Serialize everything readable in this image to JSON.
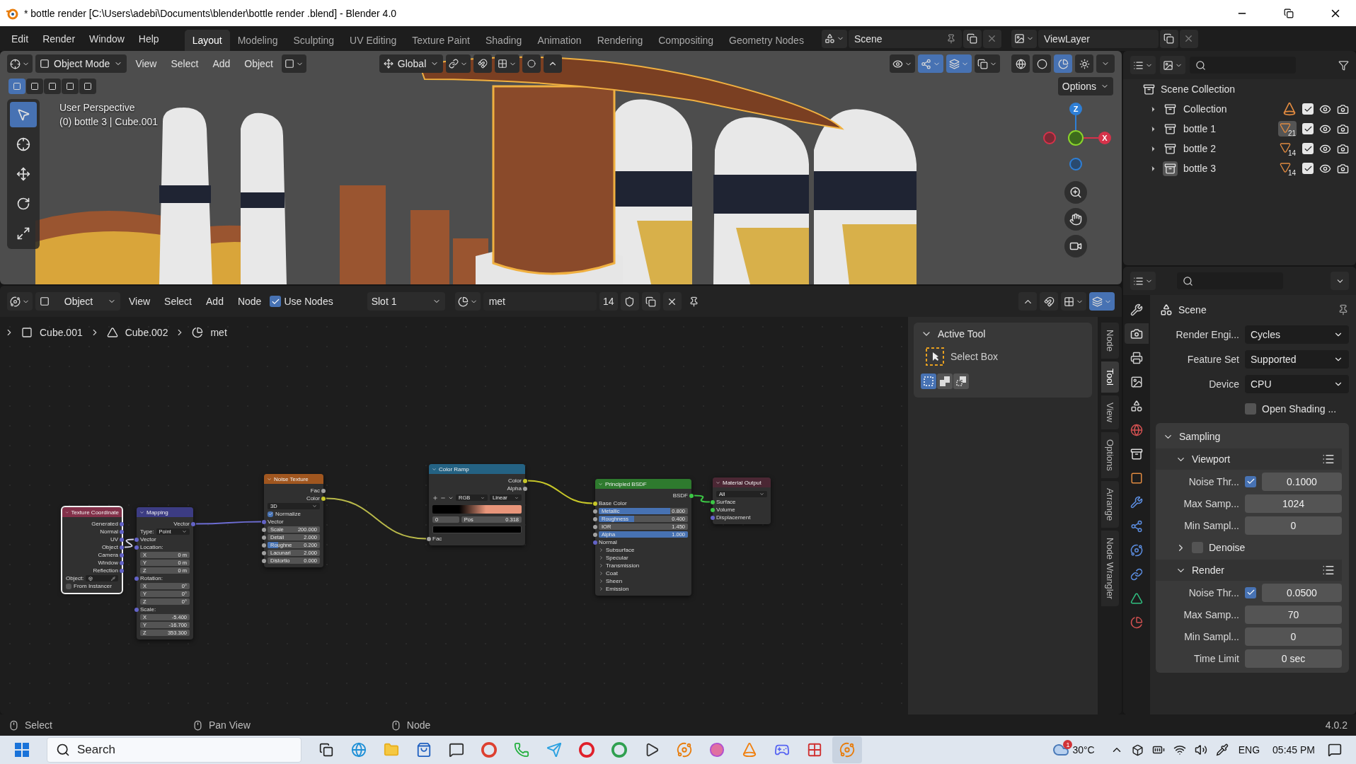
{
  "window": {
    "title": "* bottle render  [C:\\Users\\adebi\\Documents\\blender\\bottle render .blend] - Blender 4.0"
  },
  "menu": [
    "Edit",
    "Render",
    "Window",
    "Help"
  ],
  "workspaces": [
    {
      "label": "Layout",
      "selected": true
    },
    {
      "label": "Modeling",
      "selected": false
    },
    {
      "label": "Sculpting",
      "selected": false
    },
    {
      "label": "UV Editing",
      "selected": false
    },
    {
      "label": "Texture Paint",
      "selected": false
    },
    {
      "label": "Shading",
      "selected": false
    },
    {
      "label": "Animation",
      "selected": false
    },
    {
      "label": "Rendering",
      "selected": false
    },
    {
      "label": "Compositing",
      "selected": false
    },
    {
      "label": "Geometry Nodes",
      "selected": false
    }
  ],
  "scene": {
    "name": "Scene"
  },
  "view_layer": {
    "name": "ViewLayer"
  },
  "viewport": {
    "mode": "Object Mode",
    "menus": [
      "View",
      "Select",
      "Add",
      "Object"
    ],
    "orientation": "Global",
    "options": "Options",
    "info": [
      "User Perspective",
      "(0) bottle 3 | Cube.001"
    ],
    "axes": [
      "Z",
      "X"
    ],
    "toggles": [
      {
        "kind": "visibility",
        "selected": false
      },
      {
        "kind": "gizmo",
        "selected": true
      },
      {
        "kind": "overlay",
        "selected": true
      },
      {
        "kind": "xray",
        "selected": false
      }
    ],
    "shading": [
      {
        "kind": "wireframe",
        "selected": false
      },
      {
        "kind": "solid",
        "selected": false
      },
      {
        "kind": "material",
        "selected": true
      },
      {
        "kind": "rendered",
        "selected": false
      }
    ],
    "tools": [
      {
        "kind": "select",
        "selected": true
      },
      {
        "kind": "cursor",
        "selected": false
      },
      {
        "kind": "move",
        "selected": false
      },
      {
        "kind": "rotate",
        "selected": false
      },
      {
        "kind": "scale",
        "selected": false
      }
    ]
  },
  "node_editor": {
    "editor": "Object",
    "menus": [
      "View",
      "Select",
      "Add",
      "Node"
    ],
    "use_nodes": {
      "label": "Use Nodes",
      "checked": true
    },
    "slot": "Slot 1",
    "material": "met",
    "users": "14",
    "breadcrumbs": [
      {
        "kind": "object",
        "label": "Cube.001"
      },
      {
        "kind": "mesh",
        "label": "Cube.002"
      },
      {
        "kind": "material",
        "label": "met"
      }
    ],
    "nodes": [
      {
        "title": "Texture Coordinate",
        "kind": "input",
        "selected": true,
        "rows": [
          {
            "kind": "output",
            "label": "Generated",
            "color": "#6363c7"
          },
          {
            "kind": "output",
            "label": "Normal",
            "color": "#6363c7"
          },
          {
            "kind": "output",
            "label": "UV",
            "color": "#6363c7"
          },
          {
            "kind": "output",
            "label": "Object",
            "color": "#6363c7"
          },
          {
            "kind": "output",
            "label": "Camera",
            "color": "#6363c7"
          },
          {
            "kind": "output",
            "label": "Window",
            "color": "#6363c7"
          },
          {
            "kind": "output",
            "label": "Reflection",
            "color": "#6363c7"
          },
          {
            "kind": "object_field",
            "label": "Object:"
          },
          {
            "kind": "checkbox",
            "label": "From Instancer",
            "checked": false
          }
        ]
      },
      {
        "title": "Mapping",
        "kind": "vector",
        "selected": false,
        "rows": [
          {
            "kind": "output",
            "label": "Vector",
            "color": "#6363c7"
          },
          {
            "kind": "dropdown",
            "label": "Type:",
            "value": "Point"
          },
          {
            "kind": "input",
            "label": "Vector",
            "color": "#6363c7"
          },
          {
            "kind": "input",
            "label": "Location:",
            "color": "#6363c7"
          },
          {
            "kind": "axis",
            "label": "X",
            "value": "0 m"
          },
          {
            "kind": "axis",
            "label": "Y",
            "value": "0 m"
          },
          {
            "kind": "axis",
            "label": "Z",
            "value": "0 m"
          },
          {
            "kind": "input",
            "label": "Rotation:",
            "color": "#6363c7"
          },
          {
            "kind": "axis",
            "label": "X",
            "value": "0°"
          },
          {
            "kind": "axis",
            "label": "Y",
            "value": "0°"
          },
          {
            "kind": "axis",
            "label": "Z",
            "value": "0°"
          },
          {
            "kind": "input",
            "label": "Scale:",
            "color": "#6363c7"
          },
          {
            "kind": "axis",
            "label": "X",
            "value": "-5.400"
          },
          {
            "kind": "axis",
            "label": "Y",
            "value": "-16.700"
          },
          {
            "kind": "axis",
            "label": "Z",
            "value": "353.300"
          }
        ]
      },
      {
        "title": "Noise Texture",
        "kind": "texture",
        "selected": false,
        "rows": [
          {
            "kind": "output",
            "label": "Fac",
            "color": "#a1a1a1"
          },
          {
            "kind": "output",
            "label": "Color",
            "color": "#c7c729"
          },
          {
            "kind": "dropdown",
            "value": "3D"
          },
          {
            "kind": "checkbox",
            "label": "Normalize",
            "checked": true
          },
          {
            "kind": "input",
            "label": "Vector",
            "color": "#6363c7"
          },
          {
            "kind": "number",
            "label": "Scale",
            "value": "200.000",
            "color": "#a1a1a1"
          },
          {
            "kind": "number",
            "label": "Detail",
            "value": "2.000",
            "color": "#a1a1a1"
          },
          {
            "kind": "slider",
            "label": "Roughne",
            "value": "0.200",
            "level": 0.2,
            "color": "#a1a1a1"
          },
          {
            "kind": "number",
            "label": "Lacunari",
            "value": "2.000",
            "color": "#a1a1a1"
          },
          {
            "kind": "number",
            "label": "Distortio",
            "value": "0.000",
            "color": "#a1a1a1"
          }
        ]
      },
      {
        "title": "Color Ramp",
        "kind": "converter",
        "selected": false,
        "rows": [
          {
            "kind": "output",
            "label": "Color",
            "color": "#c7c729"
          },
          {
            "kind": "output",
            "label": "Alpha",
            "color": "#a1a1a1"
          },
          {
            "kind": "ramp_tools",
            "mode": "RGB",
            "interpolation": "Linear"
          },
          {
            "kind": "ramp"
          },
          {
            "kind": "stop",
            "index": "0",
            "label": "Pos",
            "value": "0.318"
          },
          {
            "kind": "swatch"
          },
          {
            "kind": "input",
            "label": "Fac",
            "color": "#a1a1a1"
          }
        ]
      },
      {
        "title": "Principled BSDF",
        "kind": "shader",
        "selected": false,
        "rows": [
          {
            "kind": "output",
            "label": "BSDF",
            "color": "#3cc745"
          },
          {
            "kind": "input",
            "label": "Base Color",
            "color": "#c7c729"
          },
          {
            "kind": "slider",
            "label": "Metallic",
            "value": "0.800",
            "level": 0.8,
            "color": "#a1a1a1"
          },
          {
            "kind": "slider",
            "label": "Roughness",
            "value": "0.400",
            "level": 0.4,
            "color": "#a1a1a1"
          },
          {
            "kind": "number",
            "label": "IOR",
            "value": "1.450",
            "color": "#a1a1a1"
          },
          {
            "kind": "slider",
            "label": "Alpha",
            "value": "1.000",
            "level": 1,
            "color": "#a1a1a1"
          },
          {
            "kind": "input",
            "label": "Normal",
            "color": "#6363c7"
          },
          {
            "kind": "panel",
            "label": "Subsurface"
          },
          {
            "kind": "panel",
            "label": "Specular"
          },
          {
            "kind": "panel",
            "label": "Transmission"
          },
          {
            "kind": "panel",
            "label": "Coat"
          },
          {
            "kind": "panel",
            "label": "Sheen"
          },
          {
            "kind": "panel",
            "label": "Emission"
          }
        ]
      },
      {
        "title": "Material Output",
        "kind": "output",
        "selected": false,
        "rows": [
          {
            "kind": "dropdown",
            "value": "All"
          },
          {
            "kind": "input",
            "label": "Surface",
            "color": "#3cc745"
          },
          {
            "kind": "input",
            "label": "Volume",
            "color": "#3cc745"
          },
          {
            "kind": "input",
            "label": "Displacement",
            "color": "#6363c7"
          }
        ]
      }
    ],
    "sidebar": {
      "panel": "Active Tool",
      "tool": "Select Box",
      "modes": [
        {
          "kind": "new",
          "selected": true
        },
        {
          "kind": "extend",
          "selected": false
        },
        {
          "kind": "subtract",
          "selected": false
        }
      ]
    },
    "tabs": [
      {
        "label": "Node",
        "selected": false
      },
      {
        "label": "Tool",
        "selected": true
      },
      {
        "label": "View",
        "selected": false
      },
      {
        "label": "Options",
        "selected": false
      },
      {
        "label": "Arrange",
        "selected": false
      },
      {
        "label": "Node Wrangler",
        "selected": false
      }
    ]
  },
  "outliner": {
    "root": {
      "label": "Scene Collection",
      "children": [
        {
          "label": "Collection",
          "kind": "cone",
          "expanded": false,
          "checked": true,
          "selected": false
        },
        {
          "label": "bottle 1",
          "kind": "mesh",
          "count": "21",
          "active_data": true,
          "expanded": false,
          "checked": true,
          "selected": false
        },
        {
          "label": "bottle 2",
          "kind": "mesh",
          "count": "14",
          "active_data": false,
          "expanded": false,
          "checked": true,
          "selected": false
        },
        {
          "label": "bottle 3",
          "kind": "mesh",
          "count": "14",
          "active_data": false,
          "expanded": false,
          "checked": true,
          "selected": true
        }
      ]
    }
  },
  "properties": {
    "tabs": [
      {
        "kind": "tool",
        "selected": false
      },
      {
        "kind": "render",
        "selected": true
      },
      {
        "kind": "output",
        "selected": false
      },
      {
        "kind": "view_layer",
        "selected": false
      },
      {
        "kind": "scene",
        "selected": false
      },
      {
        "kind": "world",
        "selected": false
      },
      {
        "kind": "collection",
        "selected": false
      },
      {
        "kind": "object",
        "selected": false
      },
      {
        "kind": "modifiers",
        "selected": false
      },
      {
        "kind": "particles",
        "selected": false
      },
      {
        "kind": "physics",
        "selected": false
      },
      {
        "kind": "constraints",
        "selected": false
      },
      {
        "kind": "data",
        "selected": false
      },
      {
        "kind": "material",
        "selected": false
      }
    ],
    "context": "Scene",
    "fields": [
      {
        "kind": "dropdown",
        "label": "Render Engi...",
        "value": "Cycles"
      },
      {
        "kind": "dropdown",
        "label": "Feature Set",
        "value": "Supported"
      },
      {
        "kind": "dropdown",
        "label": "Device",
        "value": "CPU"
      },
      {
        "kind": "checkbox",
        "label": "Open Shading ...",
        "checked": false
      }
    ],
    "panels": [
      {
        "title": "Sampling",
        "expanded": true,
        "subpanels": [
          {
            "title": "Viewport",
            "expanded": true,
            "fields": [
              {
                "kind": "toggle_number",
                "label": "Noise Thr...",
                "checked": true,
                "value": "0.1000"
              },
              {
                "kind": "number",
                "label": "Max Samp...",
                "value": "1024"
              },
              {
                "kind": "number",
                "label": "Min Sampl...",
                "value": "0"
              }
            ],
            "children": [
              {
                "title": "Denoise",
                "expanded": false,
                "checked": false
              }
            ]
          },
          {
            "title": "Render",
            "expanded": true,
            "fields": [
              {
                "kind": "toggle_number",
                "label": "Noise Thr...",
                "checked": true,
                "value": "0.0500"
              },
              {
                "kind": "number",
                "label": "Max Samp...",
                "value": "70"
              },
              {
                "kind": "number",
                "label": "Min Sampl...",
                "value": "0"
              },
              {
                "kind": "number",
                "label": "Time Limit",
                "value": "0 sec"
              }
            ]
          }
        ]
      }
    ]
  },
  "status_bar": {
    "hints": [
      "Select",
      "Pan View",
      "Node"
    ],
    "version": "4.0.2"
  },
  "taskbar": {
    "search": "Search",
    "badge": "1",
    "temperature": "30°C",
    "language": "ENG",
    "time": "05:45 PM"
  }
}
